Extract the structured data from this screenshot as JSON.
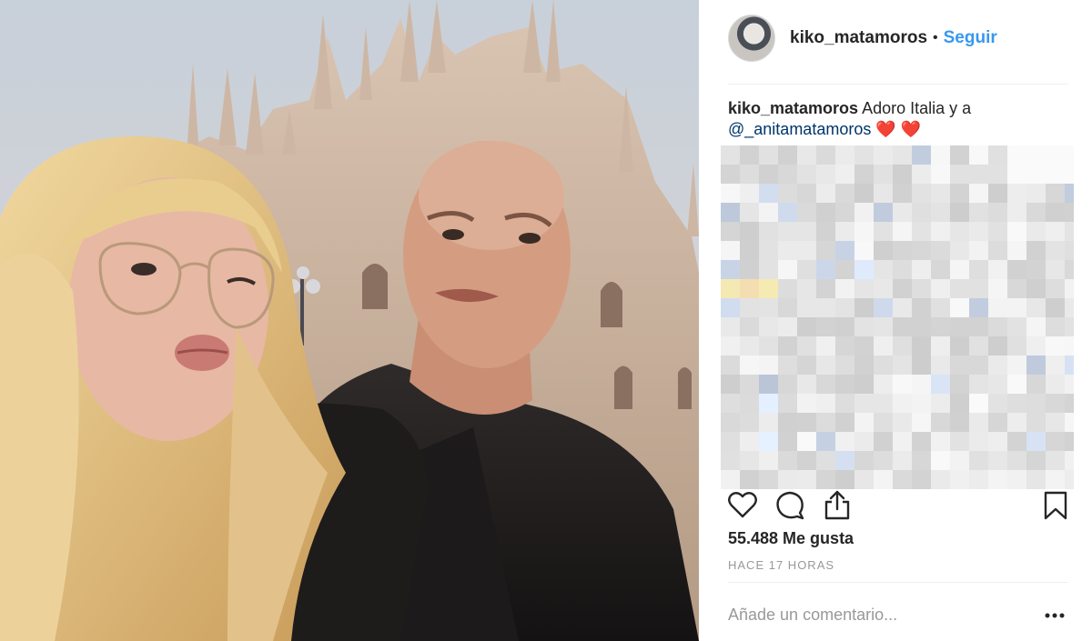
{
  "post": {
    "username": "kiko_matamoros",
    "follow_label": "Seguir",
    "separator": "•",
    "caption": {
      "user": "kiko_matamoros",
      "text": "Adoro Italia y a",
      "mention": "@_anitamatamoros",
      "emoji": "❤️ ❤️"
    },
    "likes": "55.488 Me gusta",
    "time": "HACE 17 HORAS",
    "comment_placeholder": "Añade un comentario..."
  },
  "icons": {
    "like": "heart-icon",
    "comment": "comment-bubble-icon",
    "share": "share-icon",
    "save": "bookmark-icon",
    "more": "more-options-icon"
  },
  "colors": {
    "link": "#3897f0",
    "mention": "#003569",
    "muted": "#999999",
    "text": "#262626",
    "divider": "#efefef"
  }
}
